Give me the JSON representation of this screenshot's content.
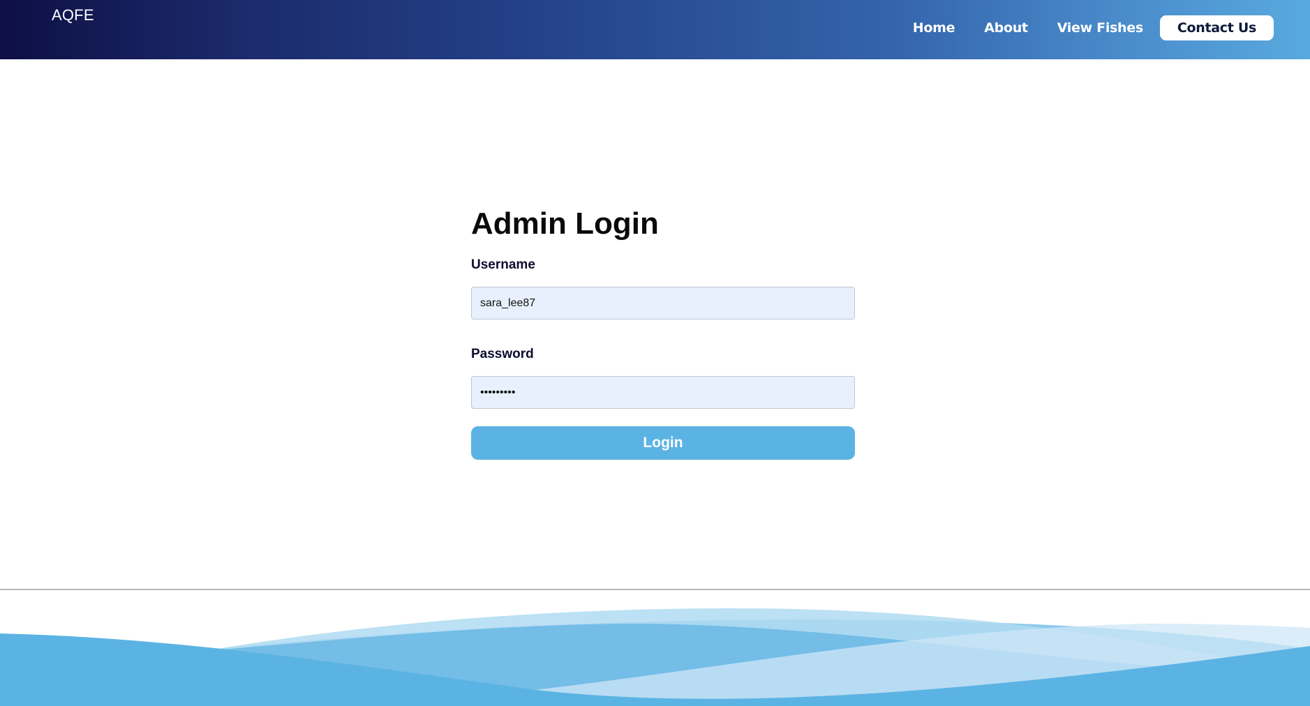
{
  "header": {
    "brand": "AQFE",
    "nav": {
      "home": "Home",
      "about": "About",
      "view_fishes": "View Fishes",
      "contact_us": "Contact Us"
    }
  },
  "login": {
    "title": "Admin Login",
    "username_label": "Username",
    "username_value": "sara_lee87",
    "password_label": "Password",
    "password_value": "sara12345",
    "button_label": "Login"
  },
  "colors": {
    "header_gradient_start": "#0d0f45",
    "header_gradient_end": "#58aade",
    "accent": "#5bb3e3",
    "input_background": "#e8f0fe"
  }
}
